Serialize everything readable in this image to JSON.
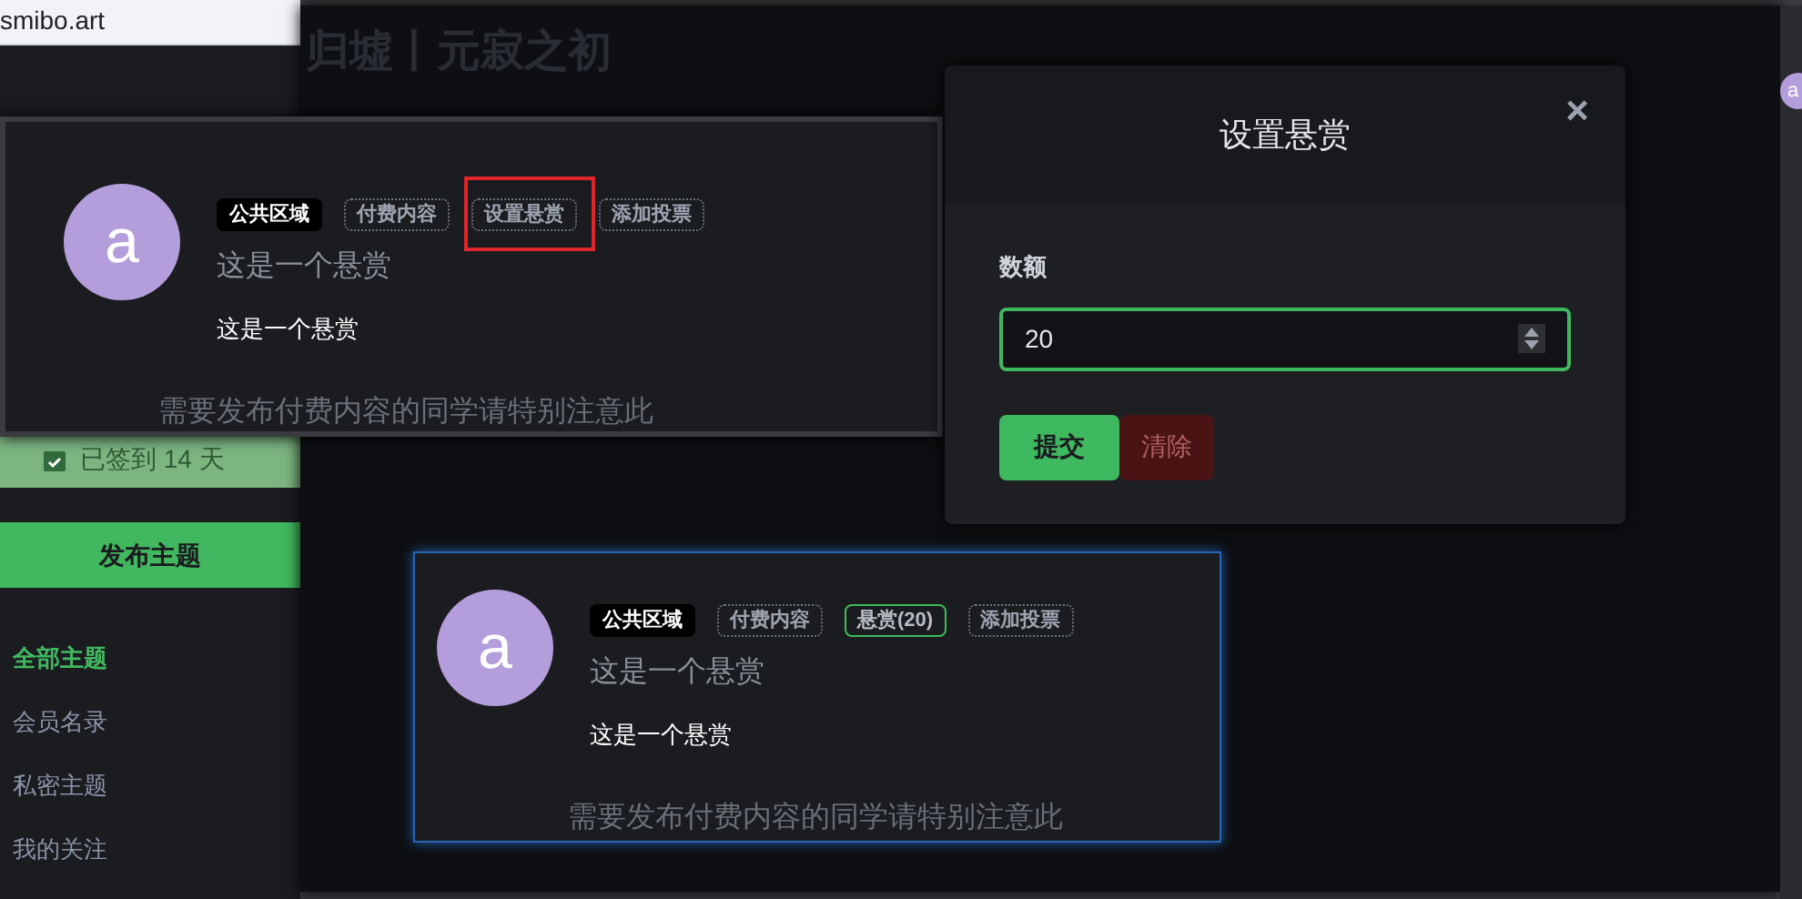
{
  "browser": {
    "url": "smibo.art"
  },
  "sidebar": {
    "checkin": "已签到 14 天",
    "publish_button": "发布主题",
    "items": [
      {
        "label": "全部主题",
        "selected": true
      },
      {
        "label": "会员名录",
        "selected": false
      },
      {
        "label": "私密主题",
        "selected": false
      },
      {
        "label": "我的关注",
        "selected": false
      }
    ]
  },
  "forum": {
    "title": "归墟丨元寂之初",
    "side_avatar": "a"
  },
  "cards": [
    {
      "avatar": "a",
      "title": "这是一个悬赏",
      "body": "这是一个悬赏",
      "notice": "需要发布付费内容的同学请特别注意此",
      "tags": [
        {
          "label": "公共区域",
          "kind": "solid",
          "highlighted": false
        },
        {
          "label": "付费内容",
          "kind": "dotted",
          "highlighted": false
        },
        {
          "label": "设置悬赏",
          "kind": "dotted",
          "highlighted": true
        },
        {
          "label": "添加投票",
          "kind": "dotted",
          "highlighted": false
        }
      ]
    },
    {
      "avatar": "a",
      "title": "这是一个悬赏",
      "body": "这是一个悬赏",
      "notice": "需要发布付费内容的同学请特别注意此",
      "tags": [
        {
          "label": "公共区域",
          "kind": "solid",
          "highlighted": false
        },
        {
          "label": "付费内容",
          "kind": "dotted",
          "highlighted": false
        },
        {
          "label": "悬赏(20)",
          "kind": "active",
          "highlighted": false
        },
        {
          "label": "添加投票",
          "kind": "dotted",
          "highlighted": false
        }
      ]
    }
  ],
  "dialog": {
    "title": "设置悬赏",
    "close": "×",
    "field_label": "数额",
    "value": "20",
    "buttons": [
      {
        "label": "提交",
        "kind": "primary"
      },
      {
        "label": "清除",
        "kind": "danger"
      }
    ]
  }
}
